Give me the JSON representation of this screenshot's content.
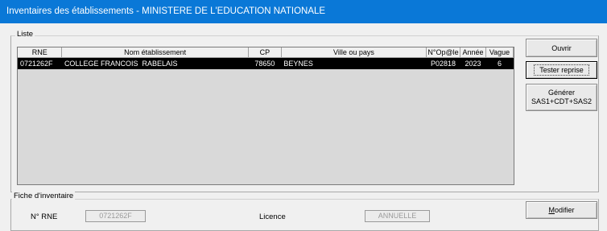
{
  "window": {
    "title": "Inventaires des établissements - MINISTERE DE L'EDUCATION NATIONALE"
  },
  "liste": {
    "legend": "Liste",
    "columns": [
      "RNE",
      "Nom établissement",
      "CP",
      "Ville ou pays",
      "N°Op@le",
      "Année",
      "Vague"
    ],
    "rows": [
      {
        "rne": "0721262F",
        "nom": "COLLEGE FRANCOIS  RABELAIS",
        "cp": "78650",
        "ville": "BEYNES",
        "opale": "P02818",
        "annee": "2023",
        "vague": "6"
      }
    ]
  },
  "buttons": {
    "ouvrir": "Ouvrir",
    "tester_reprise": "Tester reprise",
    "generer_line1": "Générer",
    "generer_line2": "SAS1+CDT+SAS2",
    "modifier_accel": "M",
    "modifier_rest": "odifier"
  },
  "fiche": {
    "legend": "Fiche d'inventaire",
    "rne_label": "N° RNE",
    "rne_value": "0721262F",
    "licence_label": "Licence",
    "licence_value": "ANNUELLE"
  }
}
